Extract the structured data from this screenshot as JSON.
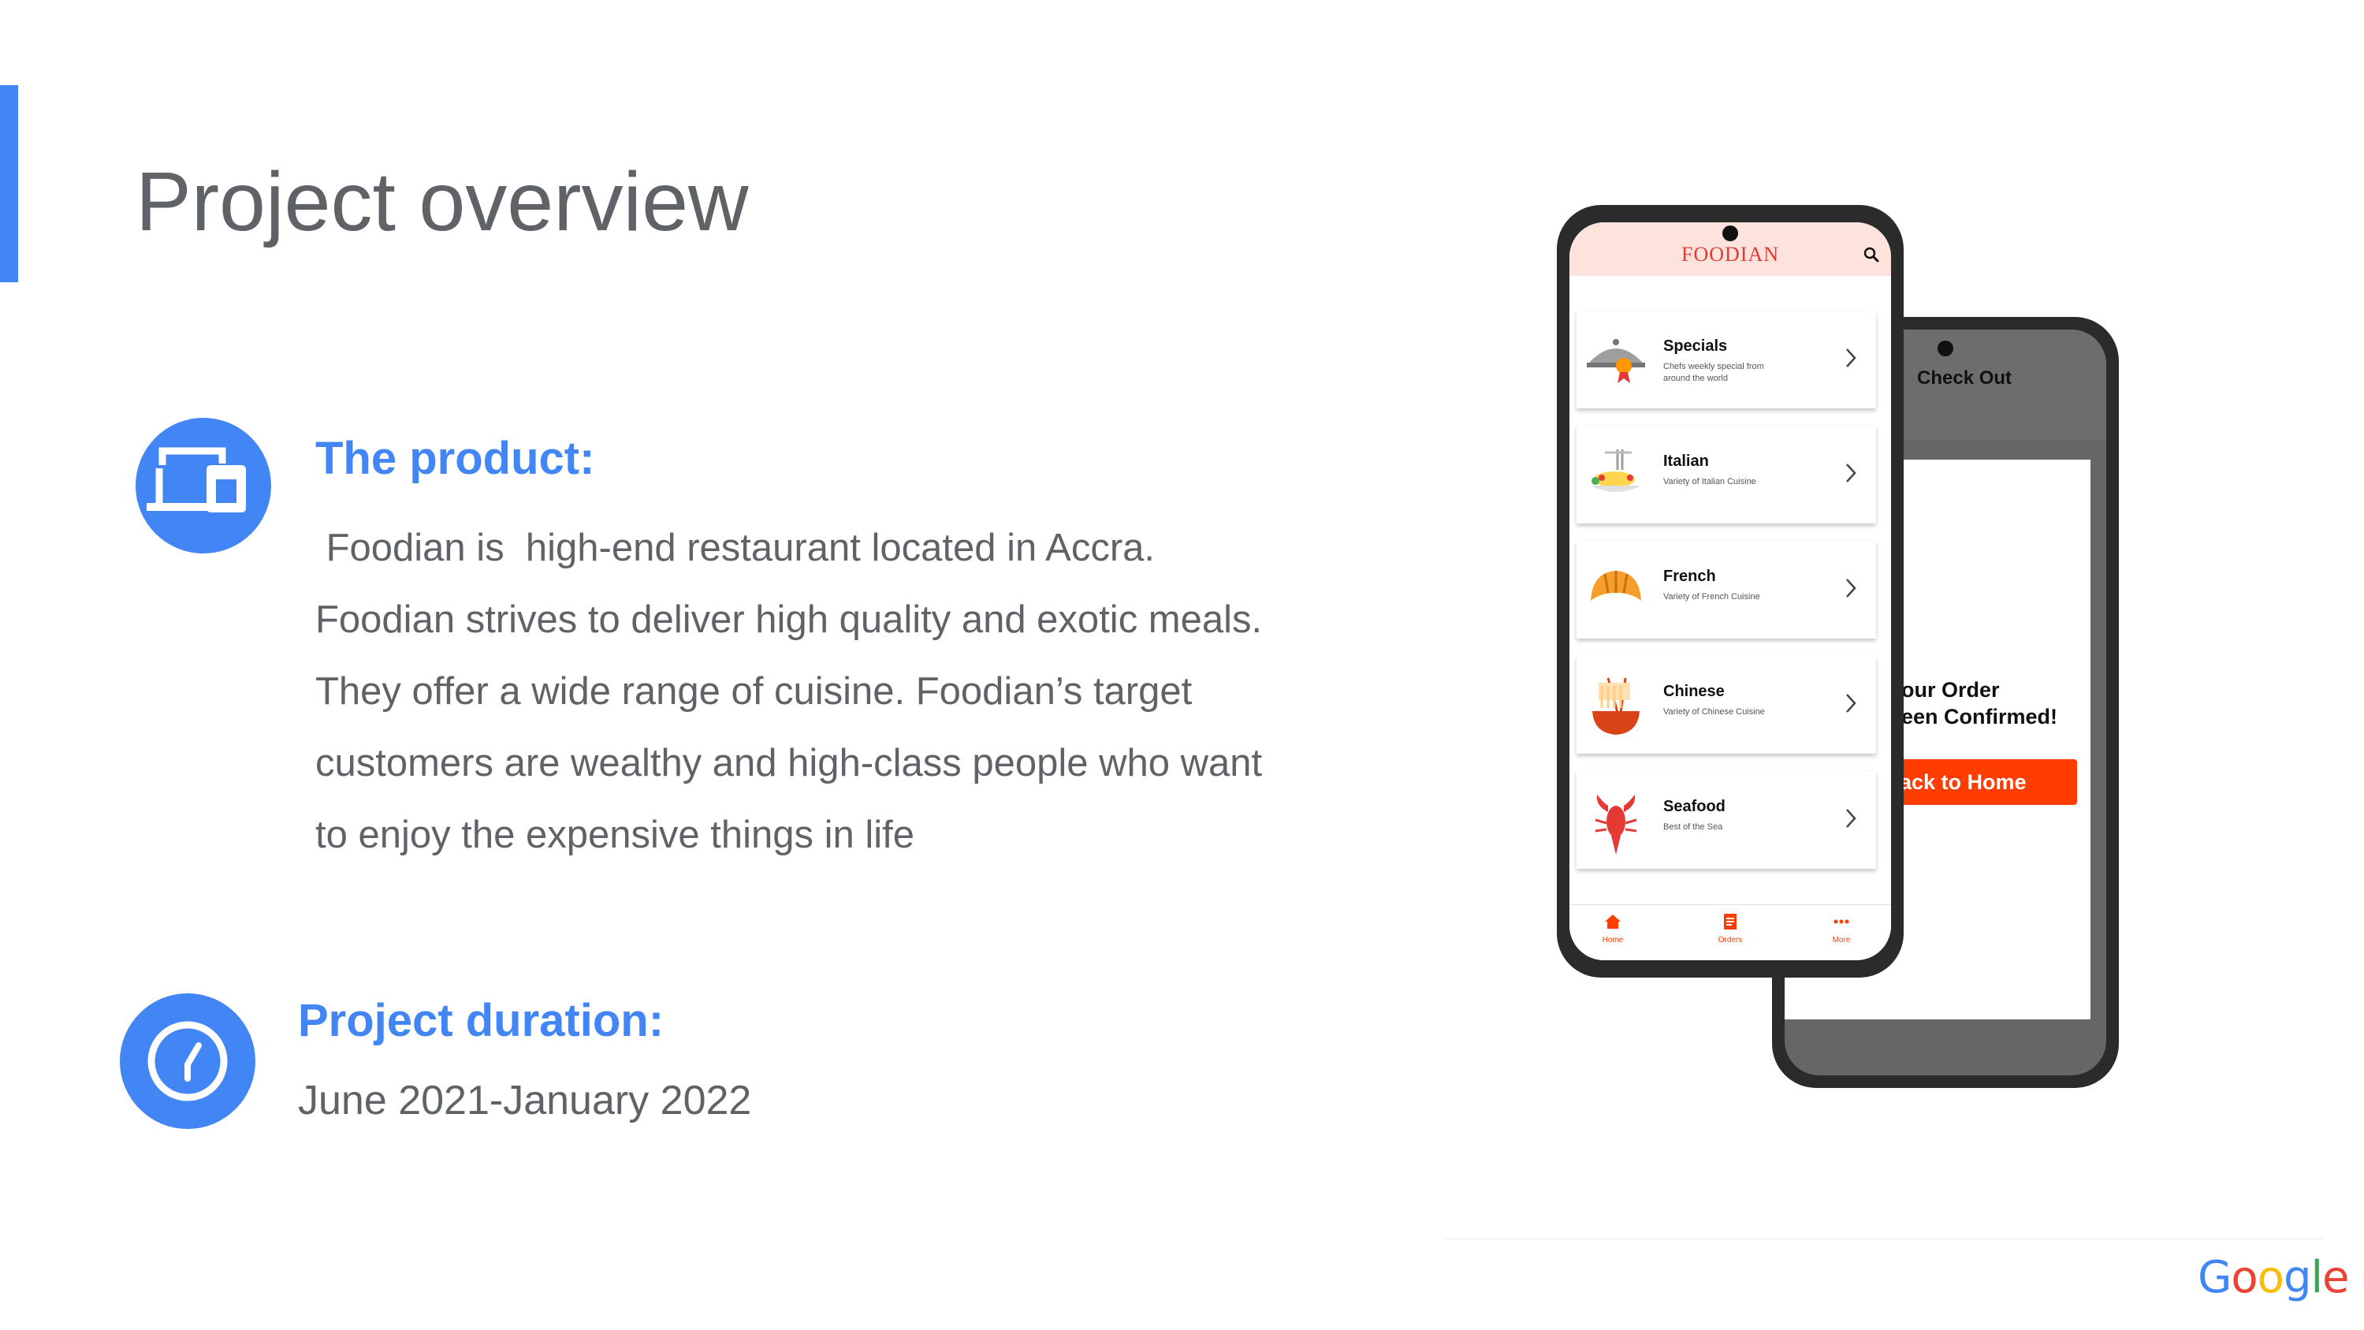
{
  "slide": {
    "title": "Project overview",
    "accent_color": "#4285f4"
  },
  "product": {
    "heading": "The product:",
    "icon": "devices-icon",
    "lines": [
      " Foodian is  high-end restaurant located in Accra.",
      "Foodian strives to deliver high quality and exotic meals.",
      "They offer a wide range of cuisine. Foodian’s target",
      "customers are wealthy and high-class people who want",
      "to enjoy the expensive things in life"
    ]
  },
  "duration": {
    "heading": "Project duration:",
    "icon": "clock-icon",
    "value": "June 2021-January 2022"
  },
  "phone_front": {
    "app_name": "FOODIAN",
    "search_icon": "search-icon",
    "menu": [
      {
        "title": "Specials",
        "subtitle": "Chefs weekly special from around the world",
        "icon": "cloche-icon"
      },
      {
        "title": "Italian",
        "subtitle": "Variety of Italian Cuisine",
        "icon": "pasta-icon"
      },
      {
        "title": "French",
        "subtitle": "Variety of French Cuisine",
        "icon": "croissant-icon"
      },
      {
        "title": "Chinese",
        "subtitle": "Variety of Chinese Cuisine",
        "icon": "noodles-icon"
      },
      {
        "title": "Seafood",
        "subtitle": "Best of the Sea",
        "icon": "lobster-icon"
      }
    ],
    "nav": [
      {
        "label": "Home",
        "icon": "home-icon"
      },
      {
        "label": "Orders",
        "icon": "orders-icon"
      },
      {
        "label": "More",
        "icon": "more-icon"
      }
    ]
  },
  "phone_back": {
    "header": "Check Out",
    "confirm_line1": "our Order",
    "confirm_line2": "een Confirmed!",
    "button": "ack to Home"
  },
  "footer": {
    "brand": "Google",
    "brand_colors": [
      "#4285f4",
      "#ea4335",
      "#fbbc05",
      "#4285f4",
      "#34a853",
      "#ea4335"
    ]
  }
}
